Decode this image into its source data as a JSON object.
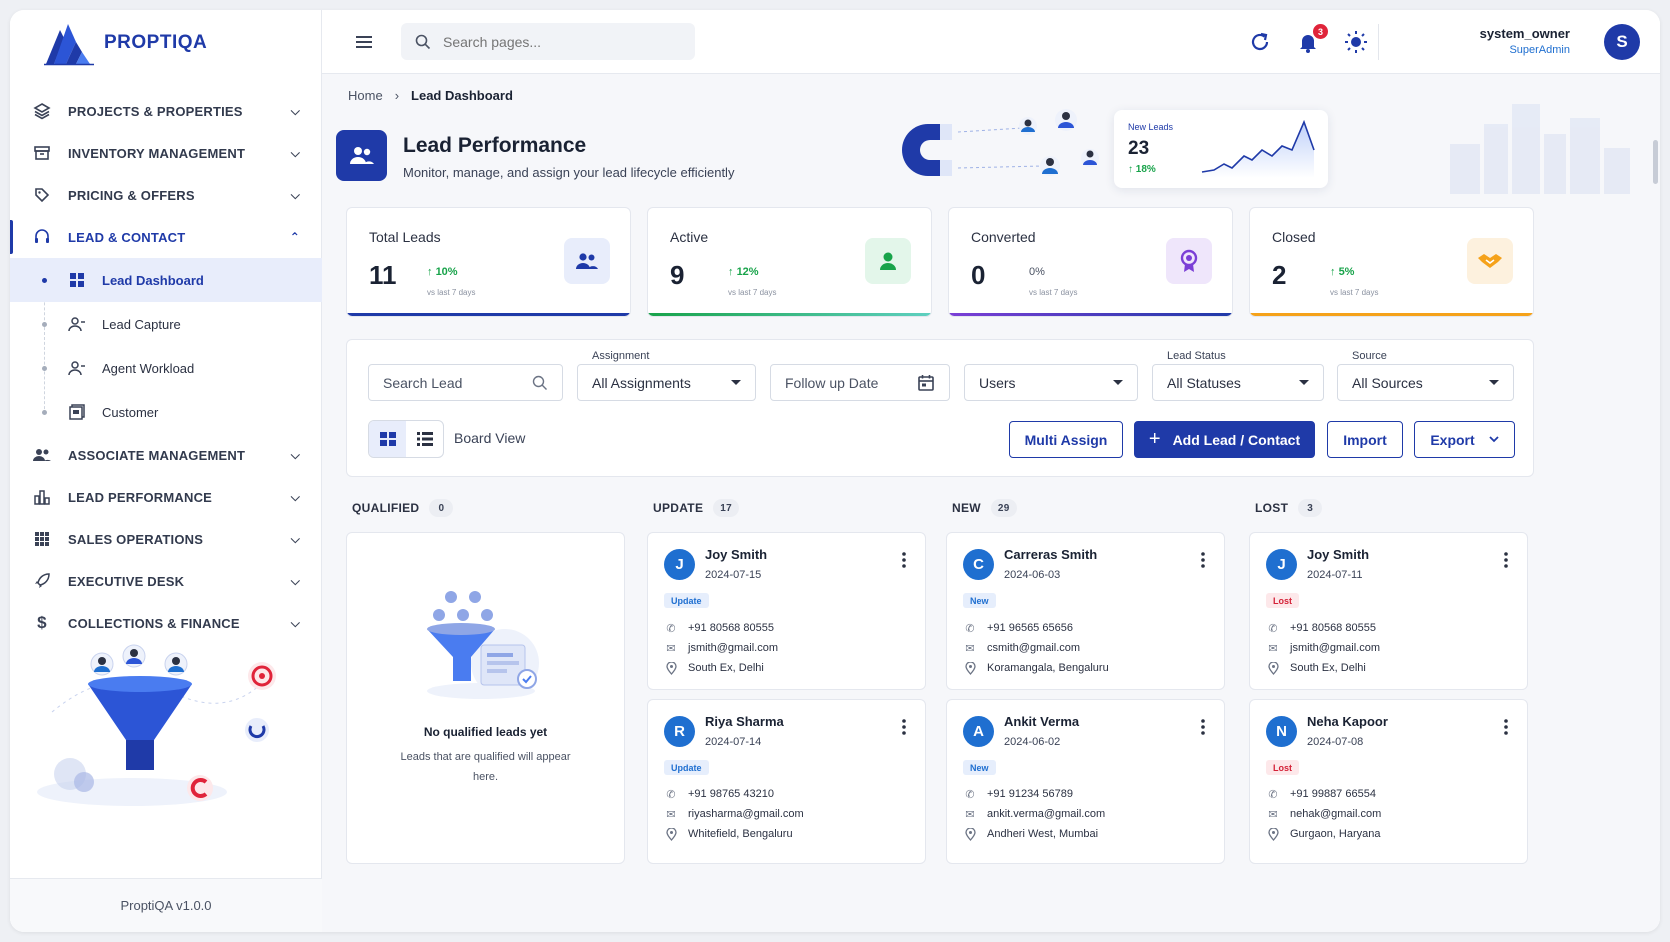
{
  "brand": {
    "name": "PROPTIQA",
    "version": "ProptiQA v1.0.0"
  },
  "sidebar": {
    "items": [
      {
        "label": "PROJECTS & PROPERTIES",
        "icon": "layers-icon"
      },
      {
        "label": "INVENTORY MANAGEMENT",
        "icon": "archive-icon"
      },
      {
        "label": "PRICING & OFFERS",
        "icon": "tag-icon"
      },
      {
        "label": "LEAD & CONTACT",
        "icon": "headset-icon",
        "expanded": true
      },
      {
        "label": "ASSOCIATE MANAGEMENT",
        "icon": "users-icon"
      },
      {
        "label": "LEAD PERFORMANCE",
        "icon": "bar-chart-icon"
      },
      {
        "label": "SALES OPERATIONS",
        "icon": "grid-icon"
      },
      {
        "label": "EXECUTIVE DESK",
        "icon": "rocket-icon"
      },
      {
        "label": "COLLECTIONS & FINANCE",
        "icon": "dollar-icon"
      }
    ],
    "sub_items": [
      {
        "label": "Lead Dashboard",
        "icon": "dashboard-icon",
        "active": true
      },
      {
        "label": "Lead Capture",
        "icon": "user-plus-icon"
      },
      {
        "label": "Agent Workload",
        "icon": "user-plus-icon"
      },
      {
        "label": "Customer",
        "icon": "id-card-icon"
      }
    ]
  },
  "topbar": {
    "search_placeholder": "Search pages...",
    "notification_count": "3",
    "user_name": "system_owner",
    "user_role": "SuperAdmin",
    "avatar_initial": "S"
  },
  "breadcrumb": {
    "home": "Home",
    "current": "Lead Dashboard"
  },
  "hero": {
    "title": "Lead Performance",
    "subtitle": "Monitor, manage, and assign your lead lifecycle efficiently",
    "mini_card": {
      "label": "New Leads",
      "value": "23",
      "change": "18%"
    }
  },
  "stats": [
    {
      "title": "Total Leads",
      "value": "11",
      "change": "10%",
      "up": true,
      "sub": "vs last 7 days",
      "color": "#1f3aa8",
      "bg": "#e8edfb"
    },
    {
      "title": "Active",
      "value": "9",
      "change": "12%",
      "up": true,
      "sub": "vs last 7 days",
      "color": "#18a34a",
      "bg": "#e3f6ea"
    },
    {
      "title": "Converted",
      "value": "0",
      "change": "0%",
      "up": false,
      "sub": "vs last 7 days",
      "color": "#7b3fd6",
      "bg": "#efe6fb"
    },
    {
      "title": "Closed",
      "value": "2",
      "change": "5%",
      "up": true,
      "sub": "vs last 7 days",
      "color": "#f5a21a",
      "bg": "#fdf1de"
    }
  ],
  "filters": {
    "search_placeholder": "Search Lead",
    "assignment_label": "Assignment",
    "assignment_value": "All Assignments",
    "followup_placeholder": "Follow up Date",
    "users_value": "Users",
    "status_label": "Lead Status",
    "status_value": "All Statuses",
    "source_label": "Source",
    "source_value": "All Sources",
    "board_view": "Board View",
    "multi_assign": "Multi Assign",
    "add_lead": "Add Lead / Contact",
    "import": "Import",
    "export": "Export"
  },
  "columns": [
    {
      "title": "QUALIFIED",
      "count": "0",
      "empty_title": "No qualified leads yet",
      "empty_sub": "Leads that are qualified will appear here.",
      "cards": []
    },
    {
      "title": "UPDATE",
      "count": "17",
      "tag": "Update",
      "tag_class": "update",
      "cards": [
        {
          "initial": "J",
          "name": "Joy Smith",
          "date": "2024-07-15",
          "phone": "+91 80568 80555",
          "email": "jsmith@gmail.com",
          "location": "South Ex, Delhi"
        },
        {
          "initial": "R",
          "name": "Riya Sharma",
          "date": "2024-07-14",
          "phone": "+91 98765 43210",
          "email": "riyasharma@gmail.com",
          "location": "Whitefield, Bengaluru"
        }
      ]
    },
    {
      "title": "NEW",
      "count": "29",
      "tag": "New",
      "tag_class": "new",
      "cards": [
        {
          "initial": "C",
          "name": "Carreras Smith",
          "date": "2024-06-03",
          "phone": "+91 96565 65656",
          "email": "csmith@gmail.com",
          "location": "Koramangala, Bengaluru"
        },
        {
          "initial": "A",
          "name": "Ankit Verma",
          "date": "2024-06-02",
          "phone": "+91 91234 56789",
          "email": "ankit.verma@gmail.com",
          "location": "Andheri West, Mumbai"
        }
      ]
    },
    {
      "title": "LOST",
      "count": "3",
      "tag": "Lost",
      "tag_class": "lost",
      "cards": [
        {
          "initial": "J",
          "name": "Joy Smith",
          "date": "2024-07-11",
          "phone": "+91 80568 80555",
          "email": "jsmith@gmail.com",
          "location": "South Ex, Delhi"
        },
        {
          "initial": "N",
          "name": "Neha Kapoor",
          "date": "2024-07-08",
          "phone": "+91 99887 66554",
          "email": "nehak@gmail.com",
          "location": "Gurgaon, Haryana"
        }
      ]
    }
  ]
}
